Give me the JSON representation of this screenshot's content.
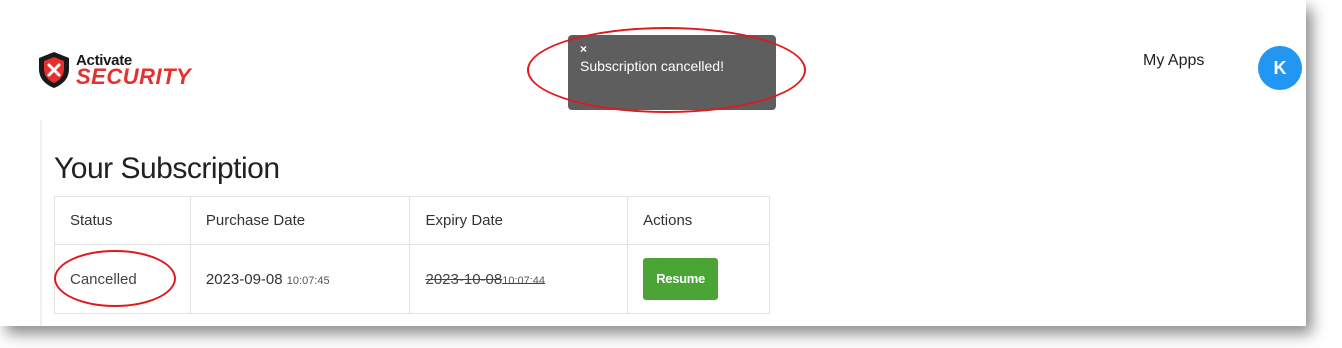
{
  "header": {
    "logo": {
      "line1": "Activate",
      "line2": "SECURITY",
      "icon": "shield-x-icon"
    },
    "nav": {
      "my_apps": "My Apps"
    },
    "avatar": {
      "initial": "K",
      "color": "#2196f3"
    }
  },
  "toast": {
    "close_symbol": "×",
    "message": "Subscription cancelled!",
    "background": "#5e5e5e"
  },
  "annotations": {
    "color": "#e0191e"
  },
  "main": {
    "title": "Your Subscription",
    "table": {
      "headers": [
        "Status",
        "Purchase Date",
        "Expiry Date",
        "Actions"
      ],
      "rows": [
        {
          "status": "Cancelled",
          "purchase_date": "2023-09-08",
          "purchase_time": "10:07:45",
          "expiry_date": "2023-10-08",
          "expiry_time": "10:07:44",
          "action_label": "Resume"
        }
      ]
    },
    "accent_green": "#4aa534"
  }
}
